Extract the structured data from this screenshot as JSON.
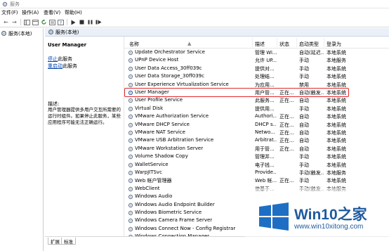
{
  "window": {
    "title": "服务"
  },
  "menu": [
    "文件(F)",
    "操作(A)",
    "查看(V)",
    "帮助(H)"
  ],
  "tree": {
    "root_label": "服务(本地)"
  },
  "panel": {
    "header": "服务(本地)"
  },
  "description": {
    "service_name": "User Manager",
    "stop_link": "停止",
    "stop_suffix": "此服务",
    "restart_link": "重启动",
    "restart_suffix": "此服务",
    "label": "描述:",
    "text": "用户管理器提供多用户交互所需要的运行时组件。如果停止此服务，某些应用程序可能无法正确运行。"
  },
  "columns": {
    "name": "名称",
    "description": "描述",
    "status": "状态",
    "startup": "启动类型",
    "logon": "登录为"
  },
  "services": [
    {
      "name": "Update Orchestrator Service",
      "desc": "管理 Wi...",
      "status": "",
      "startup": "自动(延迟...",
      "logon": "本地系统"
    },
    {
      "name": "UPnP Device Host",
      "desc": "允许 UP...",
      "status": "",
      "startup": "手动",
      "logon": "本地服务"
    },
    {
      "name": "User Data Access_30ff039c",
      "desc": "提供对...",
      "status": "",
      "startup": "手动",
      "logon": "本地系统"
    },
    {
      "name": "User Data Storage_30ff039c",
      "desc": "处理结...",
      "status": "",
      "startup": "手动",
      "logon": "本地系统"
    },
    {
      "name": "User Experience Virtualization Service",
      "desc": "为应用...",
      "status": "",
      "startup": "禁用",
      "logon": "本地系统"
    },
    {
      "name": "User Manager",
      "desc": "用户管...",
      "status": "正在...",
      "startup": "自动(触发...",
      "logon": "本地系统"
    },
    {
      "name": "User Profile Service",
      "desc": "此服务...",
      "status": "正在...",
      "startup": "自动",
      "logon": "本地系统"
    },
    {
      "name": "Virtual Disk",
      "desc": "提供用...",
      "status": "",
      "startup": "手动",
      "logon": "本地系统"
    },
    {
      "name": "VMware Authorization Service",
      "desc": "Authori...",
      "status": "正在...",
      "startup": "自动",
      "logon": "本地系统"
    },
    {
      "name": "VMware DHCP Service",
      "desc": "DHCP s...",
      "status": "正在...",
      "startup": "自动",
      "logon": "本地系统"
    },
    {
      "name": "VMware NAT Service",
      "desc": "Netwo...",
      "status": "正在...",
      "startup": "自动",
      "logon": "本地系统"
    },
    {
      "name": "VMware USB Arbitration Service",
      "desc": "Arbitrat...",
      "status": "正在...",
      "startup": "自动",
      "logon": "本地系统"
    },
    {
      "name": "VMware Workstation Server",
      "desc": "用于管...",
      "status": "正在...",
      "startup": "自动",
      "logon": "本地系统"
    },
    {
      "name": "Volume Shadow Copy",
      "desc": "管理并...",
      "status": "",
      "startup": "手动",
      "logon": "本地系统"
    },
    {
      "name": "WalletService",
      "desc": "电子钱...",
      "status": "",
      "startup": "手动",
      "logon": "本地系统"
    },
    {
      "name": "WarpJITSvc",
      "desc": "Provide...",
      "status": "",
      "startup": "手动(触发...",
      "logon": "本地服务"
    },
    {
      "name": "Web 帐户管理器",
      "desc": "Web 帐...",
      "status": "正在...",
      "startup": "手动",
      "logon": "本地系统"
    },
    {
      "name": "WebClient",
      "desc": "使基于...",
      "status": "",
      "startup": "手动(触发...",
      "logon": "本地服务"
    },
    {
      "name": "Windows Audio",
      "desc": "",
      "status": "",
      "startup": "",
      "logon": ""
    },
    {
      "name": "Windows Audio Endpoint Builder",
      "desc": "",
      "status": "",
      "startup": "",
      "logon": ""
    },
    {
      "name": "Windows Biometric Service",
      "desc": "",
      "status": "",
      "startup": "",
      "logon": ""
    },
    {
      "name": "Windows Camera Frame Server",
      "desc": "",
      "status": "",
      "startup": "",
      "logon": ""
    },
    {
      "name": "Windows Connect Now - Config Registrar",
      "desc": "",
      "status": "",
      "startup": "",
      "logon": ""
    },
    {
      "name": "Windows Connection Manager",
      "desc": "",
      "status": "",
      "startup": "",
      "logon": ""
    }
  ],
  "selected_service": "User Manager",
  "tabs": [
    "扩展",
    "标准"
  ],
  "watermark": {
    "brand_win": "Win10",
    "brand_suffix": "之家",
    "url": "www.win10xitong.com"
  },
  "colors": {
    "highlight_border": "#e12a2a",
    "link": "#0645ad",
    "brand": "#1e5a9e"
  }
}
